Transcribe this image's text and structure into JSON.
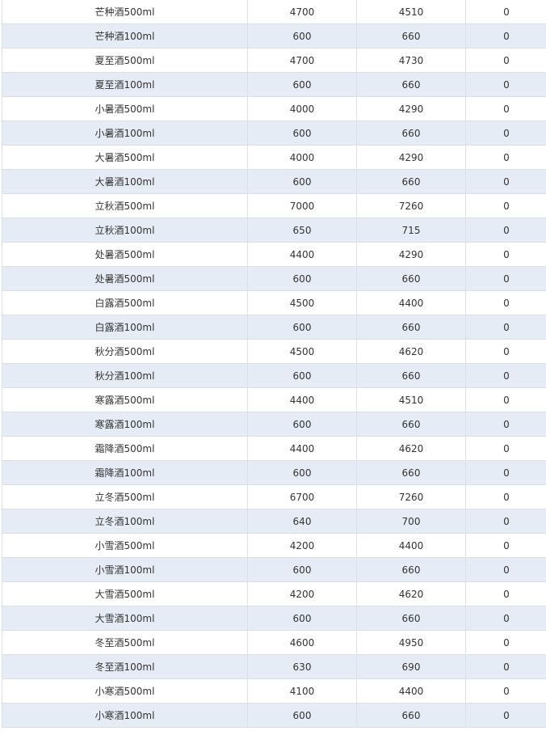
{
  "table": {
    "rows": [
      [
        "芒种酒500ml",
        "4700",
        "4510",
        "0"
      ],
      [
        "芒种酒100ml",
        "600",
        "660",
        "0"
      ],
      [
        "夏至酒500ml",
        "4700",
        "4730",
        "0"
      ],
      [
        "夏至酒100ml",
        "600",
        "660",
        "0"
      ],
      [
        "小暑酒500ml",
        "4000",
        "4290",
        "0"
      ],
      [
        "小暑酒100ml",
        "600",
        "660",
        "0"
      ],
      [
        "大暑酒500ml",
        "4000",
        "4290",
        "0"
      ],
      [
        "大暑酒100ml",
        "600",
        "660",
        "0"
      ],
      [
        "立秋酒500ml",
        "7000",
        "7260",
        "0"
      ],
      [
        "立秋酒100ml",
        "650",
        "715",
        "0"
      ],
      [
        "处暑酒500ml",
        "4400",
        "4290",
        "0"
      ],
      [
        "处暑酒500ml",
        "600",
        "660",
        "0"
      ],
      [
        "白露酒500ml",
        "4500",
        "4400",
        "0"
      ],
      [
        "白露酒100ml",
        "600",
        "660",
        "0"
      ],
      [
        "秋分酒500ml",
        "4500",
        "4620",
        "0"
      ],
      [
        "秋分酒100ml",
        "600",
        "660",
        "0"
      ],
      [
        "寒露酒500ml",
        "4400",
        "4510",
        "0"
      ],
      [
        "寒露酒100ml",
        "600",
        "660",
        "0"
      ],
      [
        "霜降酒500ml",
        "4400",
        "4620",
        "0"
      ],
      [
        "霜降酒100ml",
        "600",
        "660",
        "0"
      ],
      [
        "立冬酒500ml",
        "6700",
        "7260",
        "0"
      ],
      [
        "立冬酒100ml",
        "640",
        "700",
        "0"
      ],
      [
        "小雪酒500ml",
        "4200",
        "4400",
        "0"
      ],
      [
        "小雪酒100ml",
        "600",
        "660",
        "0"
      ],
      [
        "大雪酒500ml",
        "4200",
        "4620",
        "0"
      ],
      [
        "大雪酒100ml",
        "600",
        "660",
        "0"
      ],
      [
        "冬至酒500ml",
        "4600",
        "4950",
        "0"
      ],
      [
        "冬至酒100ml",
        "630",
        "690",
        "0"
      ],
      [
        "小寒酒500ml",
        "4100",
        "4400",
        "0"
      ],
      [
        "小寒酒100ml",
        "600",
        "660",
        "0"
      ]
    ],
    "colors": {
      "border": "#dcdfe6",
      "stripe": "#e6ecf6",
      "text": "#333333"
    }
  }
}
